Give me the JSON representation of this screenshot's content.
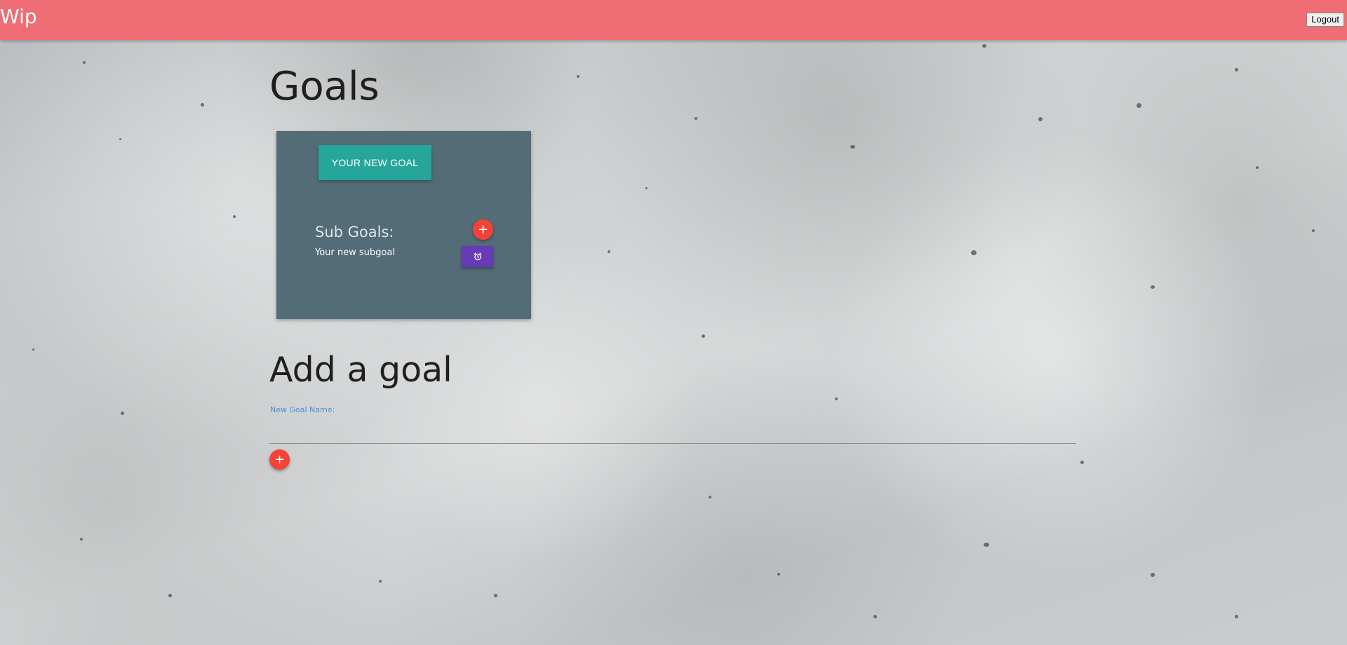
{
  "navbar": {
    "brand": "Wip",
    "logout_label": "Logout",
    "color": "#ef6e75"
  },
  "main": {
    "title": "Goals",
    "goals": [
      {
        "title": "YOUR NEW GOAL",
        "subgoals_heading": "Sub Goals:",
        "subgoals": [
          "Your new subgoal"
        ],
        "add_subgoal_icon": "+",
        "alarm_icon": "alarm-clock-icon",
        "card_color": "#536c77",
        "title_button_color": "#26a69a",
        "alarm_button_color": "#673ab7"
      }
    ]
  },
  "add_goal": {
    "heading": "Add a goal",
    "input_label": "New Goal Name:",
    "input_value": "",
    "add_icon": "+",
    "fab_color": "#f44336"
  }
}
